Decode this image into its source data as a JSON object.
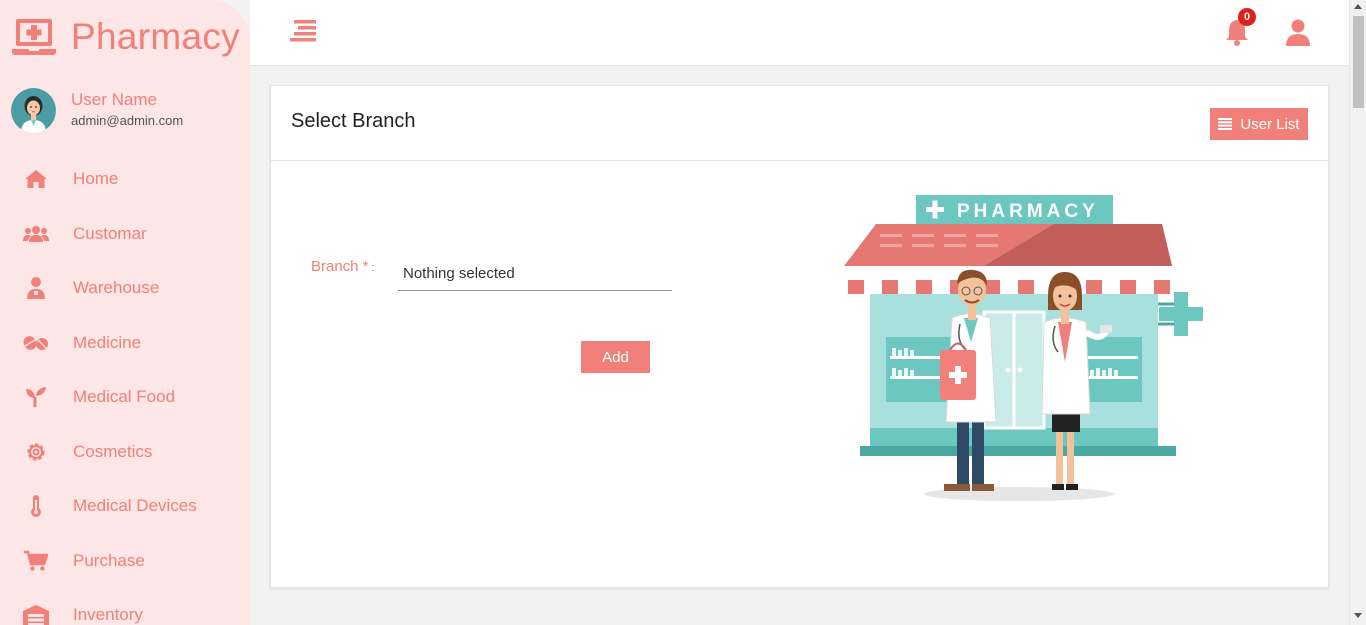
{
  "brand": {
    "name": "Pharmacy"
  },
  "user": {
    "name": "User Name",
    "email": "admin@admin.com"
  },
  "nav": [
    {
      "label": "Home",
      "icon": "home-icon"
    },
    {
      "label": "Customar",
      "icon": "users-icon"
    },
    {
      "label": "Warehouse",
      "icon": "person-icon"
    },
    {
      "label": "Medicine",
      "icon": "pills-icon"
    },
    {
      "label": "Medical Food",
      "icon": "seedling-icon"
    },
    {
      "label": "Cosmetics",
      "icon": "gear-icon"
    },
    {
      "label": "Medical Devices",
      "icon": "thermometer-icon"
    },
    {
      "label": "Purchase",
      "icon": "cart-icon"
    },
    {
      "label": "Inventory",
      "icon": "warehouse-icon"
    }
  ],
  "topbar": {
    "notification_count": "0"
  },
  "card": {
    "title": "Select Branch",
    "user_list_label": "User List",
    "branch_label": "Branch",
    "required_mark": "*",
    "colon": ":",
    "branch_value": "Nothing selected",
    "add_label": "Add"
  },
  "illustration": {
    "sign_text": "PHARMACY"
  },
  "colors": {
    "accent": "#f08079",
    "sidebar_bg": "#fde6e6",
    "badge": "#e0201b",
    "teal": "#6cc7c0"
  }
}
